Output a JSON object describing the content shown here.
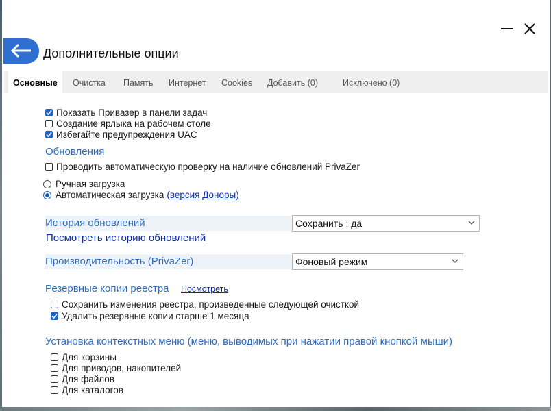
{
  "window": {
    "title": "Дополнительные опции",
    "controls": {
      "minimize_icon": "minimize-icon",
      "close_icon": "close-icon"
    },
    "back_icon": "arrow-left-icon",
    "accent": "#2e6fd1"
  },
  "tabs": [
    {
      "label": "Основные",
      "active": true
    },
    {
      "label": "Очистка"
    },
    {
      "label": "Память"
    },
    {
      "label": "Интернет"
    },
    {
      "label": "Cookies"
    },
    {
      "label": "Добавить (0)"
    },
    {
      "label": "Исключено (0)"
    }
  ],
  "general": {
    "show_in_taskbar": {
      "label": "Показать Привазер в панели задач",
      "checked": true
    },
    "desktop_shortcut": {
      "label": "Создание ярлыка на рабочем столе",
      "checked": false
    },
    "avoid_uac": {
      "label": "Избегайте предупреждения UAC",
      "checked": true
    }
  },
  "updates": {
    "heading": "Обновления",
    "auto_check": {
      "label": "Проводить автоматическую проверку на наличие обновлений PrivaZer",
      "checked": false
    },
    "manual": {
      "label": "Ручная загрузка",
      "selected": false
    },
    "automatic": {
      "label": "Автоматическая загрузка",
      "selected": true,
      "link": "(версия Доноры)"
    }
  },
  "history": {
    "label": "История обновлений",
    "select_value": "Сохранить : да",
    "link": "Посмотреть историю обновлений"
  },
  "performance": {
    "label": "Производительность (PrivaZer)",
    "select_value": "Фоновый режим"
  },
  "registry": {
    "heading": "Резервные копии реестра",
    "view_link": "Посмотреть",
    "save_changes": {
      "label": "Сохранить изменения реестра, произведенные следующей очисткой",
      "checked": false
    },
    "delete_old": {
      "label": "Удалить резервные копии старше 1 месяца",
      "checked": true
    }
  },
  "context_menu": {
    "heading": "Установка контекстных меню (меню, выводимых при нажатии правой кнопкой мыши)",
    "items": [
      {
        "label": "Для корзины",
        "checked": false
      },
      {
        "label": "Для приводов, накопителей",
        "checked": false
      },
      {
        "label": "Для файлов",
        "checked": false
      },
      {
        "label": "Для каталогов",
        "checked": false
      }
    ]
  }
}
